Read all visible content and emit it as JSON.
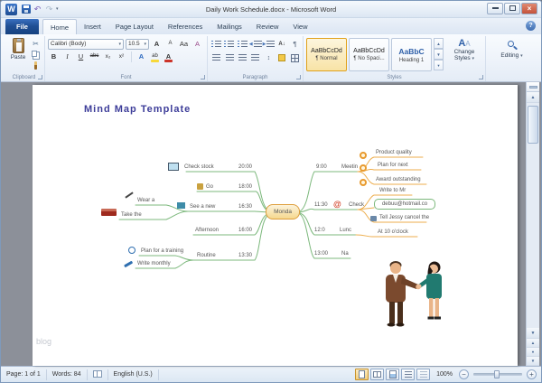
{
  "window": {
    "title": "Daily Work Schedule.docx  -  Microsoft Word"
  },
  "glyphs": {
    "word_logo": "W",
    "undo": "↶",
    "redo": "↷",
    "dropdown": "▾",
    "close": "×",
    "help": "?",
    "cut": "✂",
    "pilcrow": "¶",
    "at_sign": "@",
    "scroll_up": "▲",
    "scroll_down": "▼",
    "browse_dot": "●",
    "zoom_out": "−",
    "zoom_in": "+",
    "sort_az": "A↓",
    "spacing": "↕",
    "indent_left": "◀",
    "indent_right": "▶"
  },
  "tabs": {
    "file": "File",
    "items": [
      "Home",
      "Insert",
      "Page Layout",
      "References",
      "Mailings",
      "Review",
      "View"
    ]
  },
  "ribbon": {
    "clipboard": {
      "label": "Clipboard",
      "paste": "Paste"
    },
    "font": {
      "label": "Font",
      "name": "Calibri (Body)",
      "size": "10.5",
      "grow": "A",
      "shrink": "A",
      "case": "Aa",
      "clear": "A",
      "bold": "B",
      "italic": "I",
      "underline": "U",
      "strike": "abc",
      "subscript": "x₂",
      "superscript": "x²",
      "effects": "A",
      "highlight": "ab",
      "color": "A"
    },
    "paragraph": {
      "label": "Paragraph"
    },
    "styles": {
      "label": "Styles",
      "gallery": [
        {
          "preview": "AaBbCcDd",
          "name": "¶ Normal"
        },
        {
          "preview": "AaBbCcDd",
          "name": "¶ No Spaci..."
        },
        {
          "preview": "AaBbC",
          "name": "Heading 1"
        }
      ],
      "change_line1": "Change",
      "change_line2": "Styles"
    },
    "editing": {
      "label": "Editing"
    }
  },
  "document": {
    "title": "Mind Map Template",
    "watermark": "blog"
  },
  "mindmap": {
    "center": "Monda",
    "left": [
      {
        "time": "20:00",
        "label": "Check stock"
      },
      {
        "time": "18:00",
        "label": "Go"
      },
      {
        "time": "16:30",
        "label": "See a new"
      },
      {
        "time": "16:00",
        "label": "Afternoon"
      },
      {
        "time": "13:30",
        "label": "Routine"
      }
    ],
    "left_sub": [
      "Wear a",
      "Take the",
      "Plan for a training",
      "Write monthly"
    ],
    "right": [
      {
        "time": "9:00",
        "label": "Meetin",
        "children": [
          "Product quality",
          "Plan for next",
          "Award outstanding"
        ]
      },
      {
        "time": "11:30",
        "label": "Check",
        "children": [
          "Write to Mr",
          "debuu@hotmail.co",
          "Tell Jessy cancel the"
        ]
      },
      {
        "time": "12:0",
        "label": "Lunc",
        "children": [
          "At 10 o'clock"
        ]
      },
      {
        "time": "13:00",
        "label": "Na",
        "children": []
      }
    ]
  },
  "status": {
    "page": "Page: 1 of 1",
    "words": "Words: 84",
    "language": "English (U.S.)",
    "zoom": "100%"
  }
}
